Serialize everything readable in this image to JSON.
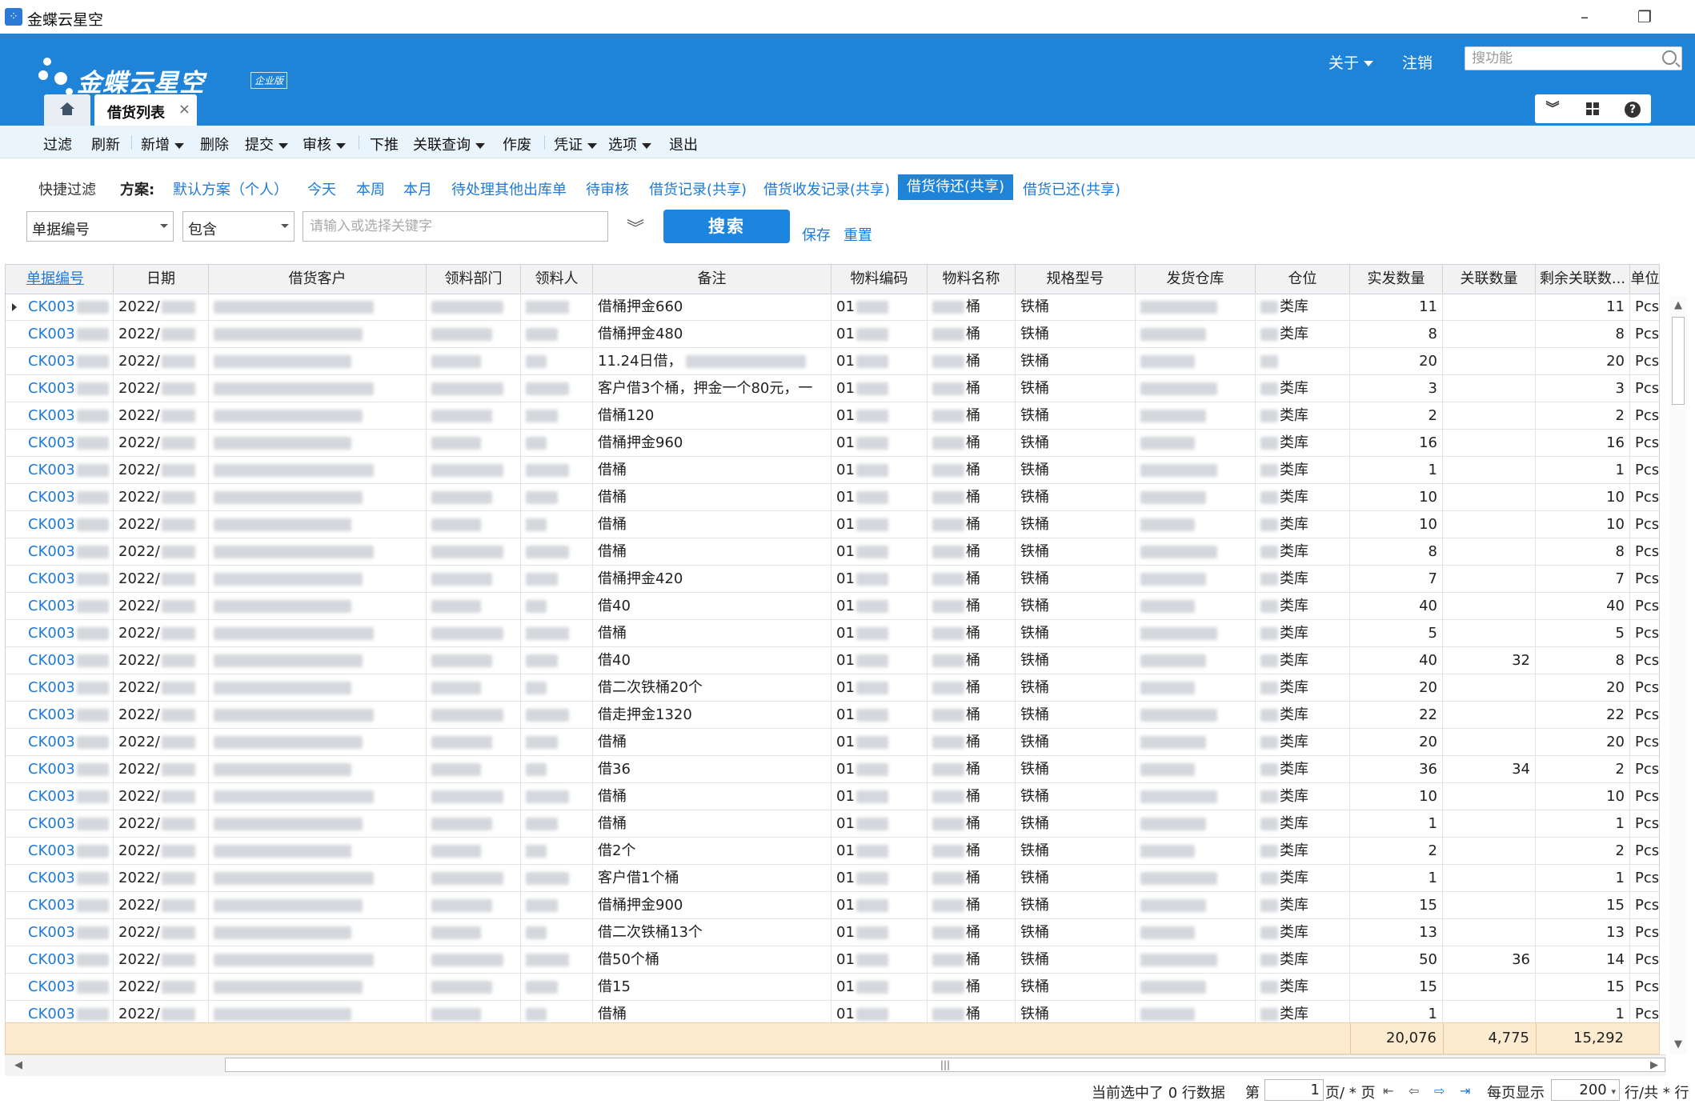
{
  "window": {
    "title": "金蝶云星空",
    "minimize": "–",
    "restore": "❐",
    "close": "✕"
  },
  "header": {
    "brand": "金蝶云星空",
    "edition": "企业版",
    "about": "关于",
    "logout": "注销",
    "search_placeholder": "搜功能"
  },
  "tabs": {
    "active_label": "借货列表",
    "close": "×"
  },
  "toolbar": {
    "filter": "过滤",
    "refresh": "刷新",
    "add": "新增",
    "delete": "删除",
    "submit": "提交",
    "audit": "审核",
    "push": "下推",
    "related_query": "关联查询",
    "void": "作废",
    "voucher": "凭证",
    "options": "选项",
    "exit": "退出"
  },
  "quick_filter": {
    "label": "快捷过滤",
    "scheme_label": "方案:",
    "items": [
      "默认方案（个人）",
      "今天",
      "本周",
      "本月",
      "待处理其他出库单",
      "待审核",
      "借货记录(共享)",
      "借货收发记录(共享)",
      "借货待还(共享)",
      "借货已还(共享)"
    ],
    "active_index": 8
  },
  "search": {
    "field": "单据编号",
    "operator": "包含",
    "keyword_placeholder": "请输入或选择关键字",
    "button": "搜索",
    "save": "保存",
    "reset": "重置"
  },
  "grid": {
    "columns": [
      "单据编号",
      "日期",
      "借货客户",
      "领料部门",
      "领料人",
      "备注",
      "物料编码",
      "物料名称",
      "规格型号",
      "发货仓库",
      "仓位",
      "实发数量",
      "关联数量",
      "剩余关联数...",
      "单位"
    ],
    "rows": [
      {
        "bill": "CK003",
        "date": "2022/",
        "remark": "借桶押金660",
        "code": "01",
        "name": "桶",
        "spec": "铁桶",
        "loc": "类库",
        "qty": "11",
        "rel": "",
        "remain": "11",
        "unit": "Pcs"
      },
      {
        "bill": "CK003",
        "date": "2022/",
        "remark": "借桶押金480",
        "code": "01",
        "name": "桶",
        "spec": "铁桶",
        "loc": "类库",
        "qty": "8",
        "rel": "",
        "remain": "8",
        "unit": "Pcs"
      },
      {
        "bill": "CK003",
        "date": "2022/",
        "remark": "11.24日借，",
        "code": "01",
        "name": "桶",
        "spec": "铁桶",
        "loc": "",
        "qty": "20",
        "rel": "",
        "remain": "20",
        "unit": "Pcs"
      },
      {
        "bill": "CK003",
        "date": "2022/",
        "remark": "客户借3个桶，押金一个80元，一",
        "code": "01",
        "name": "桶",
        "spec": "铁桶",
        "loc": "类库",
        "qty": "3",
        "rel": "",
        "remain": "3",
        "unit": "Pcs"
      },
      {
        "bill": "CK003",
        "date": "2022/",
        "remark": "借桶120",
        "code": "01",
        "name": "桶",
        "spec": "铁桶",
        "loc": "类库",
        "qty": "2",
        "rel": "",
        "remain": "2",
        "unit": "Pcs"
      },
      {
        "bill": "CK003",
        "date": "2022/",
        "remark": "借桶押金960",
        "code": "01",
        "name": "桶",
        "spec": "铁桶",
        "loc": "类库",
        "qty": "16",
        "rel": "",
        "remain": "16",
        "unit": "Pcs"
      },
      {
        "bill": "CK003",
        "date": "2022/",
        "remark": "借桶",
        "code": "01",
        "name": "桶",
        "spec": "铁桶",
        "loc": "类库",
        "qty": "1",
        "rel": "",
        "remain": "1",
        "unit": "Pcs"
      },
      {
        "bill": "CK003",
        "date": "2022/",
        "remark": "借桶",
        "code": "01",
        "name": "桶",
        "spec": "铁桶",
        "loc": "类库",
        "qty": "10",
        "rel": "",
        "remain": "10",
        "unit": "Pcs"
      },
      {
        "bill": "CK003",
        "date": "2022/",
        "remark": "借桶",
        "code": "01",
        "name": "桶",
        "spec": "铁桶",
        "loc": "类库",
        "qty": "10",
        "rel": "",
        "remain": "10",
        "unit": "Pcs"
      },
      {
        "bill": "CK003",
        "date": "2022/",
        "remark": "借桶",
        "code": "01",
        "name": "桶",
        "spec": "铁桶",
        "loc": "类库",
        "qty": "8",
        "rel": "",
        "remain": "8",
        "unit": "Pcs"
      },
      {
        "bill": "CK003",
        "date": "2022/",
        "remark": "借桶押金420",
        "code": "01",
        "name": "桶",
        "spec": "铁桶",
        "loc": "类库",
        "qty": "7",
        "rel": "",
        "remain": "7",
        "unit": "Pcs"
      },
      {
        "bill": "CK003",
        "date": "2022/",
        "remark": "借40",
        "code": "01",
        "name": "桶",
        "spec": "铁桶",
        "loc": "类库",
        "qty": "40",
        "rel": "",
        "remain": "40",
        "unit": "Pcs"
      },
      {
        "bill": "CK003",
        "date": "2022/",
        "remark": "借桶",
        "code": "01",
        "name": "桶",
        "spec": "铁桶",
        "loc": "类库",
        "qty": "5",
        "rel": "",
        "remain": "5",
        "unit": "Pcs"
      },
      {
        "bill": "CK003",
        "date": "2022/",
        "remark": "借40",
        "code": "01",
        "name": "桶",
        "spec": "铁桶",
        "loc": "类库",
        "qty": "40",
        "rel": "32",
        "remain": "8",
        "unit": "Pcs"
      },
      {
        "bill": "CK003",
        "date": "2022/",
        "remark": "借二次铁桶20个",
        "code": "01",
        "name": "桶",
        "spec": "铁桶",
        "loc": "类库",
        "qty": "20",
        "rel": "",
        "remain": "20",
        "unit": "Pcs"
      },
      {
        "bill": "CK003",
        "date": "2022/",
        "remark": "借走押金1320",
        "code": "01",
        "name": "桶",
        "spec": "铁桶",
        "loc": "类库",
        "qty": "22",
        "rel": "",
        "remain": "22",
        "unit": "Pcs"
      },
      {
        "bill": "CK003",
        "date": "2022/",
        "remark": "借桶",
        "code": "01",
        "name": "桶",
        "spec": "铁桶",
        "loc": "类库",
        "qty": "20",
        "rel": "",
        "remain": "20",
        "unit": "Pcs"
      },
      {
        "bill": "CK003",
        "date": "2022/",
        "remark": "借36",
        "code": "01",
        "name": "桶",
        "spec": "铁桶",
        "loc": "类库",
        "qty": "36",
        "rel": "34",
        "remain": "2",
        "unit": "Pcs"
      },
      {
        "bill": "CK003",
        "date": "2022/",
        "remark": "借桶",
        "code": "01",
        "name": "桶",
        "spec": "铁桶",
        "loc": "类库",
        "qty": "10",
        "rel": "",
        "remain": "10",
        "unit": "Pcs"
      },
      {
        "bill": "CK003",
        "date": "2022/",
        "remark": "借桶",
        "code": "01",
        "name": "桶",
        "spec": "铁桶",
        "loc": "类库",
        "qty": "1",
        "rel": "",
        "remain": "1",
        "unit": "Pcs"
      },
      {
        "bill": "CK003",
        "date": "2022/",
        "remark": "借2个",
        "code": "01",
        "name": "桶",
        "spec": "铁桶",
        "loc": "类库",
        "qty": "2",
        "rel": "",
        "remain": "2",
        "unit": "Pcs"
      },
      {
        "bill": "CK003",
        "date": "2022/",
        "remark": "客户借1个桶",
        "code": "01",
        "name": "桶",
        "spec": "铁桶",
        "loc": "类库",
        "qty": "1",
        "rel": "",
        "remain": "1",
        "unit": "Pcs"
      },
      {
        "bill": "CK003",
        "date": "2022/",
        "remark": "借桶押金900",
        "code": "01",
        "name": "桶",
        "spec": "铁桶",
        "loc": "类库",
        "qty": "15",
        "rel": "",
        "remain": "15",
        "unit": "Pcs"
      },
      {
        "bill": "CK003",
        "date": "2022/",
        "remark": "借二次铁桶13个",
        "code": "01",
        "name": "桶",
        "spec": "铁桶",
        "loc": "类库",
        "qty": "13",
        "rel": "",
        "remain": "13",
        "unit": "Pcs"
      },
      {
        "bill": "CK003",
        "date": "2022/",
        "remark": "借50个桶",
        "code": "01",
        "name": "桶",
        "spec": "铁桶",
        "loc": "类库",
        "qty": "50",
        "rel": "36",
        "remain": "14",
        "unit": "Pcs"
      },
      {
        "bill": "CK003",
        "date": "2022/",
        "remark": "借15",
        "code": "01",
        "name": "桶",
        "spec": "铁桶",
        "loc": "类库",
        "qty": "15",
        "rel": "",
        "remain": "15",
        "unit": "Pcs"
      },
      {
        "bill": "CK003",
        "date": "2022/",
        "remark": "借桶",
        "code": "01",
        "name": "桶",
        "spec": "铁桶",
        "loc": "类库",
        "qty": "1",
        "rel": "",
        "remain": "1",
        "unit": "Pcs"
      }
    ],
    "totals": {
      "qty": "20,076",
      "rel": "4,775",
      "remain": "15,292"
    }
  },
  "status": {
    "selected": "当前选中了 0 行数据",
    "page_prefix": "第",
    "page": "1",
    "page_suffix": "页/ * 页",
    "per_page_label": "每页显示",
    "per_page": "200",
    "rows_suffix": "行/共 * 行"
  }
}
